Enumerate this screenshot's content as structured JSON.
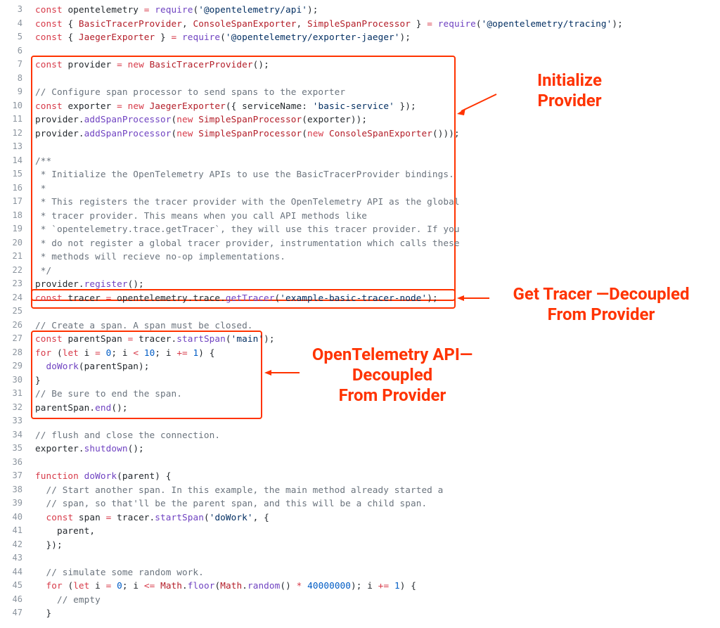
{
  "first_line_number": 3,
  "code_lines": [
    [
      [
        "kw",
        "const"
      ],
      [
        "nm",
        " opentelemetry "
      ],
      [
        "op",
        "="
      ],
      [
        "nm",
        " "
      ],
      [
        "fn",
        "require"
      ],
      [
        "nm",
        "("
      ],
      [
        "str",
        "'@opentelemetry/api'"
      ],
      [
        "nm",
        ");"
      ]
    ],
    [
      [
        "kw",
        "const"
      ],
      [
        "nm",
        " { "
      ],
      [
        "cls",
        "BasicTracerProvider"
      ],
      [
        "nm",
        ", "
      ],
      [
        "cls",
        "ConsoleSpanExporter"
      ],
      [
        "nm",
        ", "
      ],
      [
        "cls",
        "SimpleSpanProcessor"
      ],
      [
        "nm",
        " } "
      ],
      [
        "op",
        "="
      ],
      [
        "nm",
        " "
      ],
      [
        "fn",
        "require"
      ],
      [
        "nm",
        "("
      ],
      [
        "str",
        "'@opentelemetry/tracing'"
      ],
      [
        "nm",
        ");"
      ]
    ],
    [
      [
        "kw",
        "const"
      ],
      [
        "nm",
        " { "
      ],
      [
        "cls",
        "JaegerExporter"
      ],
      [
        "nm",
        " } "
      ],
      [
        "op",
        "="
      ],
      [
        "nm",
        " "
      ],
      [
        "fn",
        "require"
      ],
      [
        "nm",
        "("
      ],
      [
        "str",
        "'@opentelemetry/exporter-jaeger'"
      ],
      [
        "nm",
        ");"
      ]
    ],
    [],
    [
      [
        "kw",
        "const"
      ],
      [
        "nm",
        " provider "
      ],
      [
        "op",
        "="
      ],
      [
        "nm",
        " "
      ],
      [
        "kw",
        "new"
      ],
      [
        "nm",
        " "
      ],
      [
        "cls",
        "BasicTracerProvider"
      ],
      [
        "nm",
        "();"
      ]
    ],
    [],
    [
      [
        "com",
        "// Configure span processor to send spans to the exporter"
      ]
    ],
    [
      [
        "kw",
        "const"
      ],
      [
        "nm",
        " exporter "
      ],
      [
        "op",
        "="
      ],
      [
        "nm",
        " "
      ],
      [
        "kw",
        "new"
      ],
      [
        "nm",
        " "
      ],
      [
        "cls",
        "JaegerExporter"
      ],
      [
        "nm",
        "({ serviceName: "
      ],
      [
        "str",
        "'basic-service'"
      ],
      [
        "nm",
        " });"
      ]
    ],
    [
      [
        "nm",
        "provider."
      ],
      [
        "fn",
        "addSpanProcessor"
      ],
      [
        "nm",
        "("
      ],
      [
        "kw",
        "new"
      ],
      [
        "nm",
        " "
      ],
      [
        "cls",
        "SimpleSpanProcessor"
      ],
      [
        "nm",
        "(exporter));"
      ]
    ],
    [
      [
        "nm",
        "provider."
      ],
      [
        "fn",
        "addSpanProcessor"
      ],
      [
        "nm",
        "("
      ],
      [
        "kw",
        "new"
      ],
      [
        "nm",
        " "
      ],
      [
        "cls",
        "SimpleSpanProcessor"
      ],
      [
        "nm",
        "("
      ],
      [
        "kw",
        "new"
      ],
      [
        "nm",
        " "
      ],
      [
        "cls",
        "ConsoleSpanExporter"
      ],
      [
        "nm",
        "()));"
      ]
    ],
    [],
    [
      [
        "com",
        "/**"
      ]
    ],
    [
      [
        "com",
        " * Initialize the OpenTelemetry APIs to use the BasicTracerProvider bindings."
      ]
    ],
    [
      [
        "com",
        " *"
      ]
    ],
    [
      [
        "com",
        " * This registers the tracer provider with the OpenTelemetry API as the global"
      ]
    ],
    [
      [
        "com",
        " * tracer provider. This means when you call API methods like"
      ]
    ],
    [
      [
        "com",
        " * `opentelemetry.trace.getTracer`, they will use this tracer provider. If you"
      ]
    ],
    [
      [
        "com",
        " * do not register a global tracer provider, instrumentation which calls these"
      ]
    ],
    [
      [
        "com",
        " * methods will recieve no-op implementations."
      ]
    ],
    [
      [
        "com",
        " */"
      ]
    ],
    [
      [
        "nm",
        "provider."
      ],
      [
        "fn",
        "register"
      ],
      [
        "nm",
        "();"
      ]
    ],
    [
      [
        "kw",
        "const"
      ],
      [
        "nm",
        " tracer "
      ],
      [
        "op",
        "="
      ],
      [
        "nm",
        " opentelemetry.trace."
      ],
      [
        "fn",
        "getTracer"
      ],
      [
        "nm",
        "("
      ],
      [
        "str",
        "'example-basic-tracer-node'"
      ],
      [
        "nm",
        ");"
      ]
    ],
    [],
    [
      [
        "com",
        "// Create a span. A span must be closed."
      ]
    ],
    [
      [
        "kw",
        "const"
      ],
      [
        "nm",
        " parentSpan "
      ],
      [
        "op",
        "="
      ],
      [
        "nm",
        " tracer."
      ],
      [
        "fn",
        "startSpan"
      ],
      [
        "nm",
        "("
      ],
      [
        "str",
        "'main'"
      ],
      [
        "nm",
        ");"
      ]
    ],
    [
      [
        "kw",
        "for"
      ],
      [
        "nm",
        " ("
      ],
      [
        "kw",
        "let"
      ],
      [
        "nm",
        " i "
      ],
      [
        "op",
        "="
      ],
      [
        "nm",
        " "
      ],
      [
        "num",
        "0"
      ],
      [
        "nm",
        "; i "
      ],
      [
        "op",
        "<"
      ],
      [
        "nm",
        " "
      ],
      [
        "num",
        "10"
      ],
      [
        "nm",
        "; i "
      ],
      [
        "op",
        "+="
      ],
      [
        "nm",
        " "
      ],
      [
        "num",
        "1"
      ],
      [
        "nm",
        ") {"
      ]
    ],
    [
      [
        "nm",
        "  "
      ],
      [
        "fn",
        "doWork"
      ],
      [
        "nm",
        "(parentSpan);"
      ]
    ],
    [
      [
        "nm",
        "}"
      ]
    ],
    [
      [
        "com",
        "// Be sure to end the span."
      ]
    ],
    [
      [
        "nm",
        "parentSpan."
      ],
      [
        "fn",
        "end"
      ],
      [
        "nm",
        "();"
      ]
    ],
    [],
    [
      [
        "com",
        "// flush and close the connection."
      ]
    ],
    [
      [
        "nm",
        "exporter."
      ],
      [
        "fn",
        "shutdown"
      ],
      [
        "nm",
        "();"
      ]
    ],
    [],
    [
      [
        "kw",
        "function"
      ],
      [
        "nm",
        " "
      ],
      [
        "fn",
        "doWork"
      ],
      [
        "nm",
        "(parent) {"
      ]
    ],
    [
      [
        "nm",
        "  "
      ],
      [
        "com",
        "// Start another span. In this example, the main method already started a"
      ]
    ],
    [
      [
        "nm",
        "  "
      ],
      [
        "com",
        "// span, so that'll be the parent span, and this will be a child span."
      ]
    ],
    [
      [
        "nm",
        "  "
      ],
      [
        "kw",
        "const"
      ],
      [
        "nm",
        " span "
      ],
      [
        "op",
        "="
      ],
      [
        "nm",
        " tracer."
      ],
      [
        "fn",
        "startSpan"
      ],
      [
        "nm",
        "("
      ],
      [
        "str",
        "'doWork'"
      ],
      [
        "nm",
        ", {"
      ]
    ],
    [
      [
        "nm",
        "    parent,"
      ]
    ],
    [
      [
        "nm",
        "  });"
      ]
    ],
    [],
    [
      [
        "nm",
        "  "
      ],
      [
        "com",
        "// simulate some random work."
      ]
    ],
    [
      [
        "nm",
        "  "
      ],
      [
        "kw",
        "for"
      ],
      [
        "nm",
        " ("
      ],
      [
        "kw",
        "let"
      ],
      [
        "nm",
        " i "
      ],
      [
        "op",
        "="
      ],
      [
        "nm",
        " "
      ],
      [
        "num",
        "0"
      ],
      [
        "nm",
        "; i "
      ],
      [
        "op",
        "<="
      ],
      [
        "nm",
        " "
      ],
      [
        "cls",
        "Math"
      ],
      [
        "nm",
        "."
      ],
      [
        "fn",
        "floor"
      ],
      [
        "nm",
        "("
      ],
      [
        "cls",
        "Math"
      ],
      [
        "nm",
        "."
      ],
      [
        "fn",
        "random"
      ],
      [
        "nm",
        "() "
      ],
      [
        "op",
        "*"
      ],
      [
        "nm",
        " "
      ],
      [
        "num",
        "40000000"
      ],
      [
        "nm",
        "); i "
      ],
      [
        "op",
        "+="
      ],
      [
        "nm",
        " "
      ],
      [
        "num",
        "1"
      ],
      [
        "nm",
        ") {"
      ]
    ],
    [
      [
        "nm",
        "    "
      ],
      [
        "com",
        "// empty"
      ]
    ],
    [
      [
        "nm",
        "  }"
      ]
    ]
  ],
  "annotations": {
    "initialize": {
      "line1": "Initialize",
      "line2": "Provider"
    },
    "getTracer": {
      "line1": "Get Tracer —Decoupled",
      "line2": "From Provider"
    },
    "api": {
      "line1": "OpenTelemetry API—",
      "line2": "Decoupled",
      "line3": "From Provider"
    }
  },
  "box_ranges": {
    "box1": {
      "from_line": 7,
      "to_line": 23
    },
    "box2": {
      "from_line": 24,
      "to_line": 24
    },
    "box3": {
      "from_line": 27,
      "to_line": 32
    }
  },
  "colors": {
    "annotation": "#ff3300",
    "keyword": "#d73a49",
    "function": "#6f42c1",
    "string": "#032f62",
    "comment": "#6a737d",
    "classname": "#b31d28",
    "number": "#005cc5"
  }
}
